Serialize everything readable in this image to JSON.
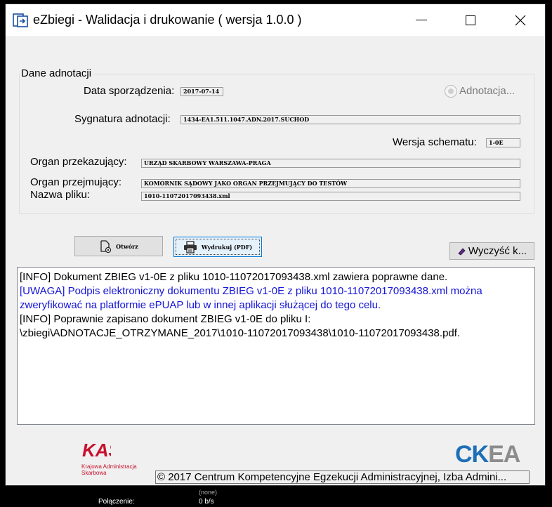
{
  "window": {
    "title": "eZbiegi - Walidacja i drukowanie ( wersja 1.0.0 )"
  },
  "group": {
    "title": "Dane adnotacji",
    "data_sporzadzenia_label": "Data sporządzenia:",
    "data_sporzadzenia_value": "2017-07-14",
    "adnotacja_radio_label": "Adnotacja...",
    "sygnatura_label": "Sygnatura adnotacji:",
    "sygnatura_value": "1434-EA1.511.1047.ADN.2017.SUCHOD",
    "wersja_label": "Wersja schematu:",
    "wersja_value": "1-0E",
    "organ_przekazujacy_label": "Organ przekazujący:",
    "organ_przekazujacy_value": "URZĄD SKARBOWY WARSZAWA-PRAGA",
    "organ_przejmujacy_label": "Organ przejmujący:",
    "organ_przejmujacy_value": "KOMORNIK SĄDOWY JAKO ORGAN PRZEJMUJĄCY DO TESTÓW",
    "nazwa_pliku_label": "Nazwa pliku:",
    "nazwa_pliku_value": "1010-11072017093438.xml"
  },
  "buttons": {
    "open_label": "Otwórz",
    "print_label": "Wydrukuj (PDF)",
    "clear_label": "Wyczyść k..."
  },
  "log": [
    {
      "kind": "info",
      "text": "[INFO] Dokument ZBIEG v1-0E z pliku 1010-11072017093438.xml zawiera poprawne dane."
    },
    {
      "kind": "warn",
      "text": "[UWAGA] Podpis elektroniczny dokumentu ZBIEG v1-0E z pliku 1010-11072017093438.xml można"
    },
    {
      "kind": "warn",
      "text": "zweryfikować na platformie ePUAP lub w innej aplikacji służącej do tego celu."
    },
    {
      "kind": "info",
      "text": "[INFO] Poprawnie zapisano dokument ZBIEG v1-0E do pliku I:"
    },
    {
      "kind": "info",
      "text": "\\zbiegi\\ADNOTACJE_OTRZYMANE_2017\\1010-11072017093438\\1010-11072017093438.pdf."
    }
  ],
  "footer": {
    "kas_logo_text": "KAS",
    "kas_line1": "Krajowa Administracja",
    "kas_line2": "Skarbowa",
    "ckea_logo_part1": "CK",
    "ckea_logo_part2": "EA",
    "copyright": "© 2017 Centrum Kompetencyjne Egzekucji Administracyjnej, Izba Admini..."
  },
  "taskbar": {
    "top_fragment": "(none)",
    "connection_label": "Połączenie:",
    "connection_value": "0 b/s"
  },
  "colors": {
    "warn_text": "#1414d6",
    "kas_red": "#c8102e",
    "ckea_blue": "#1e6fb8",
    "ckea_gray": "#8c8c8c"
  }
}
